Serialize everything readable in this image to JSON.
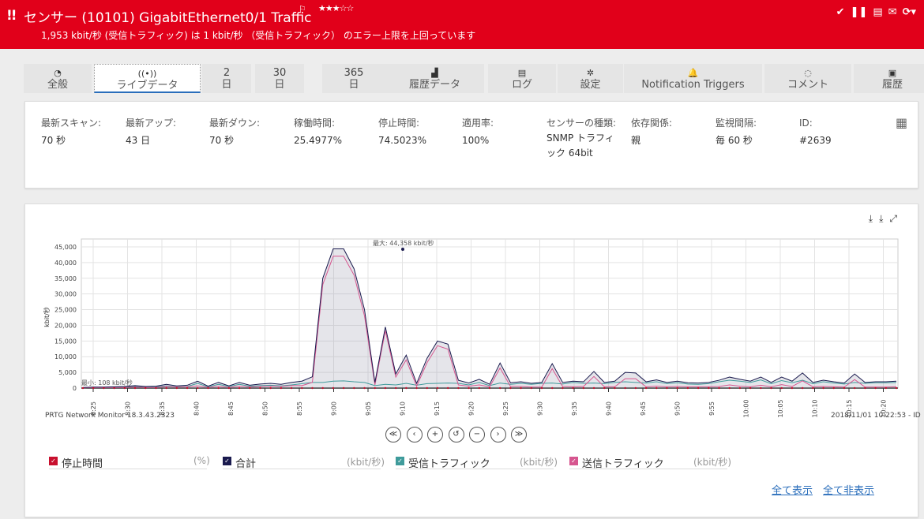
{
  "header": {
    "alert_marks": "!!",
    "title": "センサー (10101) GigabitEthernet0/1 Traffic",
    "flag": "⚐",
    "stars": "★★★☆☆",
    "message": "1,953 kbit/秒 (受信トラフィック) は 1 kbit/秒 （受信トラフィック） のエラー上限を上回っています",
    "icons": [
      "check-icon",
      "pause-icon",
      "edit-icon",
      "mail-icon",
      "refresh-icon"
    ]
  },
  "tabs": [
    {
      "icon": "◔",
      "label": "全般"
    },
    {
      "icon": "((•))",
      "label": "ライブデータ"
    },
    {
      "num": "2",
      "label": "日"
    },
    {
      "num": "30",
      "label": "日"
    },
    {
      "num": "365",
      "label": "日"
    },
    {
      "icon": "▟",
      "label": "履歴データ"
    },
    {
      "icon": "▤",
      "label": "ログ"
    },
    {
      "icon": "✲",
      "label": "設定"
    },
    {
      "icon": "🔔",
      "label": "Notification Triggers"
    },
    {
      "icon": "◌",
      "label": "コメント"
    },
    {
      "icon": "▣",
      "label": "履歴"
    }
  ],
  "stats": [
    {
      "k": "最新スキャン:",
      "v": "70 秒"
    },
    {
      "k": "最新アップ:",
      "v": "43 日"
    },
    {
      "k": "最新ダウン:",
      "v": "70 秒"
    },
    {
      "k": "稼働時間:",
      "v": "25.4977%"
    },
    {
      "k": "停止時間:",
      "v": "74.5023%"
    },
    {
      "k": "適用率:",
      "v": "100%"
    },
    {
      "k": "センサーの種類:",
      "v": "SNMP トラフィック 64bit"
    },
    {
      "k": "依存関係:",
      "v": "親"
    },
    {
      "k": "監視間隔:",
      "v": "毎 60 秒"
    },
    {
      "k": "ID:",
      "v": "#2639"
    }
  ],
  "chart_data": {
    "type": "line",
    "ylabel": "kbit/秒",
    "ylim": [
      0,
      45000
    ],
    "yticks": [
      "0",
      "5,000",
      "10,000",
      "15,000",
      "20,000",
      "25,000",
      "30,000",
      "35,000",
      "40,000",
      "45,000"
    ],
    "xticks": [
      "8:25",
      "8:30",
      "8:35",
      "8:40",
      "8:45",
      "8:50",
      "8:55",
      "9:00",
      "9:05",
      "9:10",
      "9:15",
      "9:20",
      "9:25",
      "9:30",
      "9:35",
      "9:40",
      "9:45",
      "9:50",
      "9:55",
      "10:00",
      "10:05",
      "10:10",
      "10:15",
      "10:20"
    ],
    "max_label": "最大: 44,358 kbit/秒",
    "min_label": "最小: 108 kbit/秒",
    "series": [
      {
        "name": "合計",
        "color": "#1a1a4e",
        "values": [
          200,
          300,
          300,
          400,
          500,
          800,
          500,
          600,
          1200,
          700,
          900,
          2200,
          600,
          1800,
          700,
          1800,
          900,
          1300,
          1500,
          1200,
          1800,
          2200,
          3600,
          35000,
          44358,
          44358,
          38000,
          25000,
          1800,
          19500,
          4500,
          10500,
          1500,
          9500,
          15000,
          14000,
          2500,
          1600,
          2800,
          1200,
          8000,
          1700,
          2000,
          1500,
          1800,
          7800,
          1800,
          2200,
          2000,
          5300,
          1800,
          2200,
          5000,
          4800,
          2000,
          2600,
          1800,
          2200,
          1700,
          1600,
          1800,
          2500,
          3500,
          2800,
          2200,
          3500,
          1800,
          3500,
          2200,
          4800,
          1800,
          2500,
          2000,
          1600,
          4500,
          1800,
          2000,
          2000,
          2200
        ]
      },
      {
        "name": "受信トラフィック",
        "color": "#3f9b9b",
        "values": [
          100,
          150,
          150,
          200,
          300,
          500,
          300,
          400,
          700,
          400,
          500,
          1500,
          400,
          1200,
          500,
          1200,
          600,
          800,
          900,
          700,
          1000,
          1400,
          1800,
          1800,
          2200,
          2300,
          2000,
          1800,
          800,
          1200,
          1000,
          1500,
          900,
          1400,
          1500,
          1600,
          1500,
          1000,
          1800,
          800,
          1600,
          1200,
          1500,
          1200,
          1500,
          1600,
          1300,
          1800,
          1500,
          1600,
          1400,
          1800,
          2000,
          1800,
          1600,
          2000,
          1400,
          1700,
          1300,
          1200,
          1400,
          2000,
          2500,
          2200,
          1800,
          2600,
          1400,
          2400,
          1700,
          2500,
          1400,
          2000,
          1600,
          1300,
          1800,
          1500,
          1700,
          1700,
          1800
        ]
      },
      {
        "name": "送信トラフィック",
        "color": "#d6568f",
        "values": [
          100,
          150,
          150,
          200,
          200,
          300,
          200,
          200,
          500,
          300,
          400,
          700,
          200,
          600,
          200,
          600,
          300,
          500,
          600,
          500,
          800,
          800,
          1800,
          33000,
          42000,
          42000,
          36000,
          23000,
          1000,
          18300,
          3500,
          9000,
          600,
          8100,
          13500,
          12400,
          1000,
          600,
          1000,
          400,
          6400,
          500,
          500,
          300,
          300,
          6200,
          500,
          400,
          500,
          3700,
          400,
          400,
          3000,
          3000,
          400,
          600,
          400,
          500,
          400,
          400,
          400,
          500,
          1000,
          600,
          400,
          900,
          400,
          1100,
          500,
          2300,
          400,
          500,
          400,
          300,
          2700,
          300,
          300,
          300,
          400
        ]
      },
      {
        "name": "停止時間",
        "color": "#c8102e",
        "values": []
      }
    ],
    "grid": true
  },
  "footer": {
    "left": "PRTG Network Monitor 18.3.43.2323",
    "right": "2018/11/01 10:22:53 - ID"
  },
  "nav_buttons": [
    "≪",
    "‹",
    "+",
    "↺",
    "−",
    "›",
    "≫"
  ],
  "legend": [
    {
      "label": "停止時間",
      "unit": "(%)",
      "color": "#c8102e"
    },
    {
      "label": "合計",
      "unit": "(kbit/秒)",
      "color": "#1a1a4e"
    },
    {
      "label": "受信トラフィック",
      "unit": "(kbit/秒)",
      "color": "#3f9b9b"
    },
    {
      "label": "送信トラフィック",
      "unit": "(kbit/秒)",
      "color": "#d6568f"
    }
  ],
  "links": {
    "show_all": "全て表示",
    "hide_all": "全て非表示"
  }
}
